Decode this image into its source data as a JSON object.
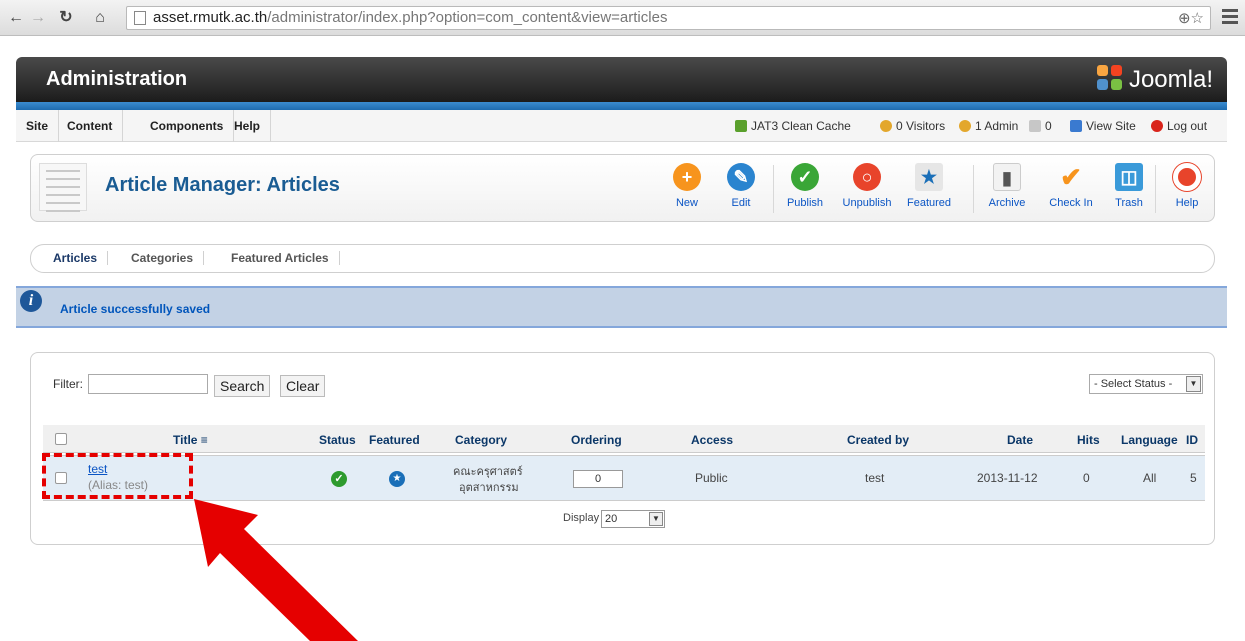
{
  "browser": {
    "url_host": "asset.rmutk.ac.th",
    "url_path": "/administrator/index.php?option=com_content&view=articles"
  },
  "header": {
    "title": "Administration",
    "brand": "Joomla!"
  },
  "menu": {
    "items": [
      "Site",
      "Content",
      "Components",
      "Help"
    ]
  },
  "status": {
    "cache": "JAT3 Clean Cache",
    "visitors": "0 Visitors",
    "admins": "1 Admin",
    "messages": "0",
    "view_site": "View Site",
    "logout": "Log out"
  },
  "toolbar": {
    "title": "Article Manager: Articles",
    "buttons": [
      {
        "label": "New",
        "icon": "plus-icon",
        "color": "#f7941d"
      },
      {
        "label": "Edit",
        "icon": "pencil-icon",
        "color": "#2a84cf"
      },
      {
        "label": "Publish",
        "icon": "check-icon",
        "color": "#3aa637"
      },
      {
        "label": "Unpublish",
        "icon": "circle-icon",
        "color": "#e8442b"
      },
      {
        "label": "Featured",
        "icon": "featured-icon",
        "color": "#1a6fb8"
      },
      {
        "label": "Archive",
        "icon": "archive-icon",
        "color": "#888888"
      },
      {
        "label": "Check In",
        "icon": "checkin-icon",
        "color": "#f7941d"
      },
      {
        "label": "Trash",
        "icon": "trash-icon",
        "color": "#3a9ad9"
      },
      {
        "label": "Help",
        "icon": "lifebuoy-icon",
        "color": "#e8442b"
      }
    ]
  },
  "subnav": {
    "items": [
      "Articles",
      "Categories",
      "Featured Articles"
    ],
    "active": "Articles"
  },
  "message": {
    "text": "Article successfully saved"
  },
  "filter": {
    "label": "Filter:",
    "value": "",
    "search_label": "Search",
    "clear_label": "Clear",
    "status_select": "- Select Status -"
  },
  "table": {
    "headers": [
      "Title",
      "Status",
      "Featured",
      "Category",
      "Ordering",
      "Access",
      "Created by",
      "Date",
      "Hits",
      "Language",
      "ID"
    ],
    "rows": [
      {
        "title": "test",
        "alias": "(Alias: test)",
        "category_line1": "คณะครุศาสตร์",
        "category_line2": "อุตสาหกรรม",
        "ordering": "0",
        "access": "Public",
        "created_by": "test",
        "date": "2013-11-12",
        "hits": "0",
        "language": "All",
        "id": "5"
      }
    ]
  },
  "pagination": {
    "label": "Display #",
    "value": "20"
  },
  "colors": {
    "accent": "#1a5c93",
    "highlight": "#e50000"
  }
}
